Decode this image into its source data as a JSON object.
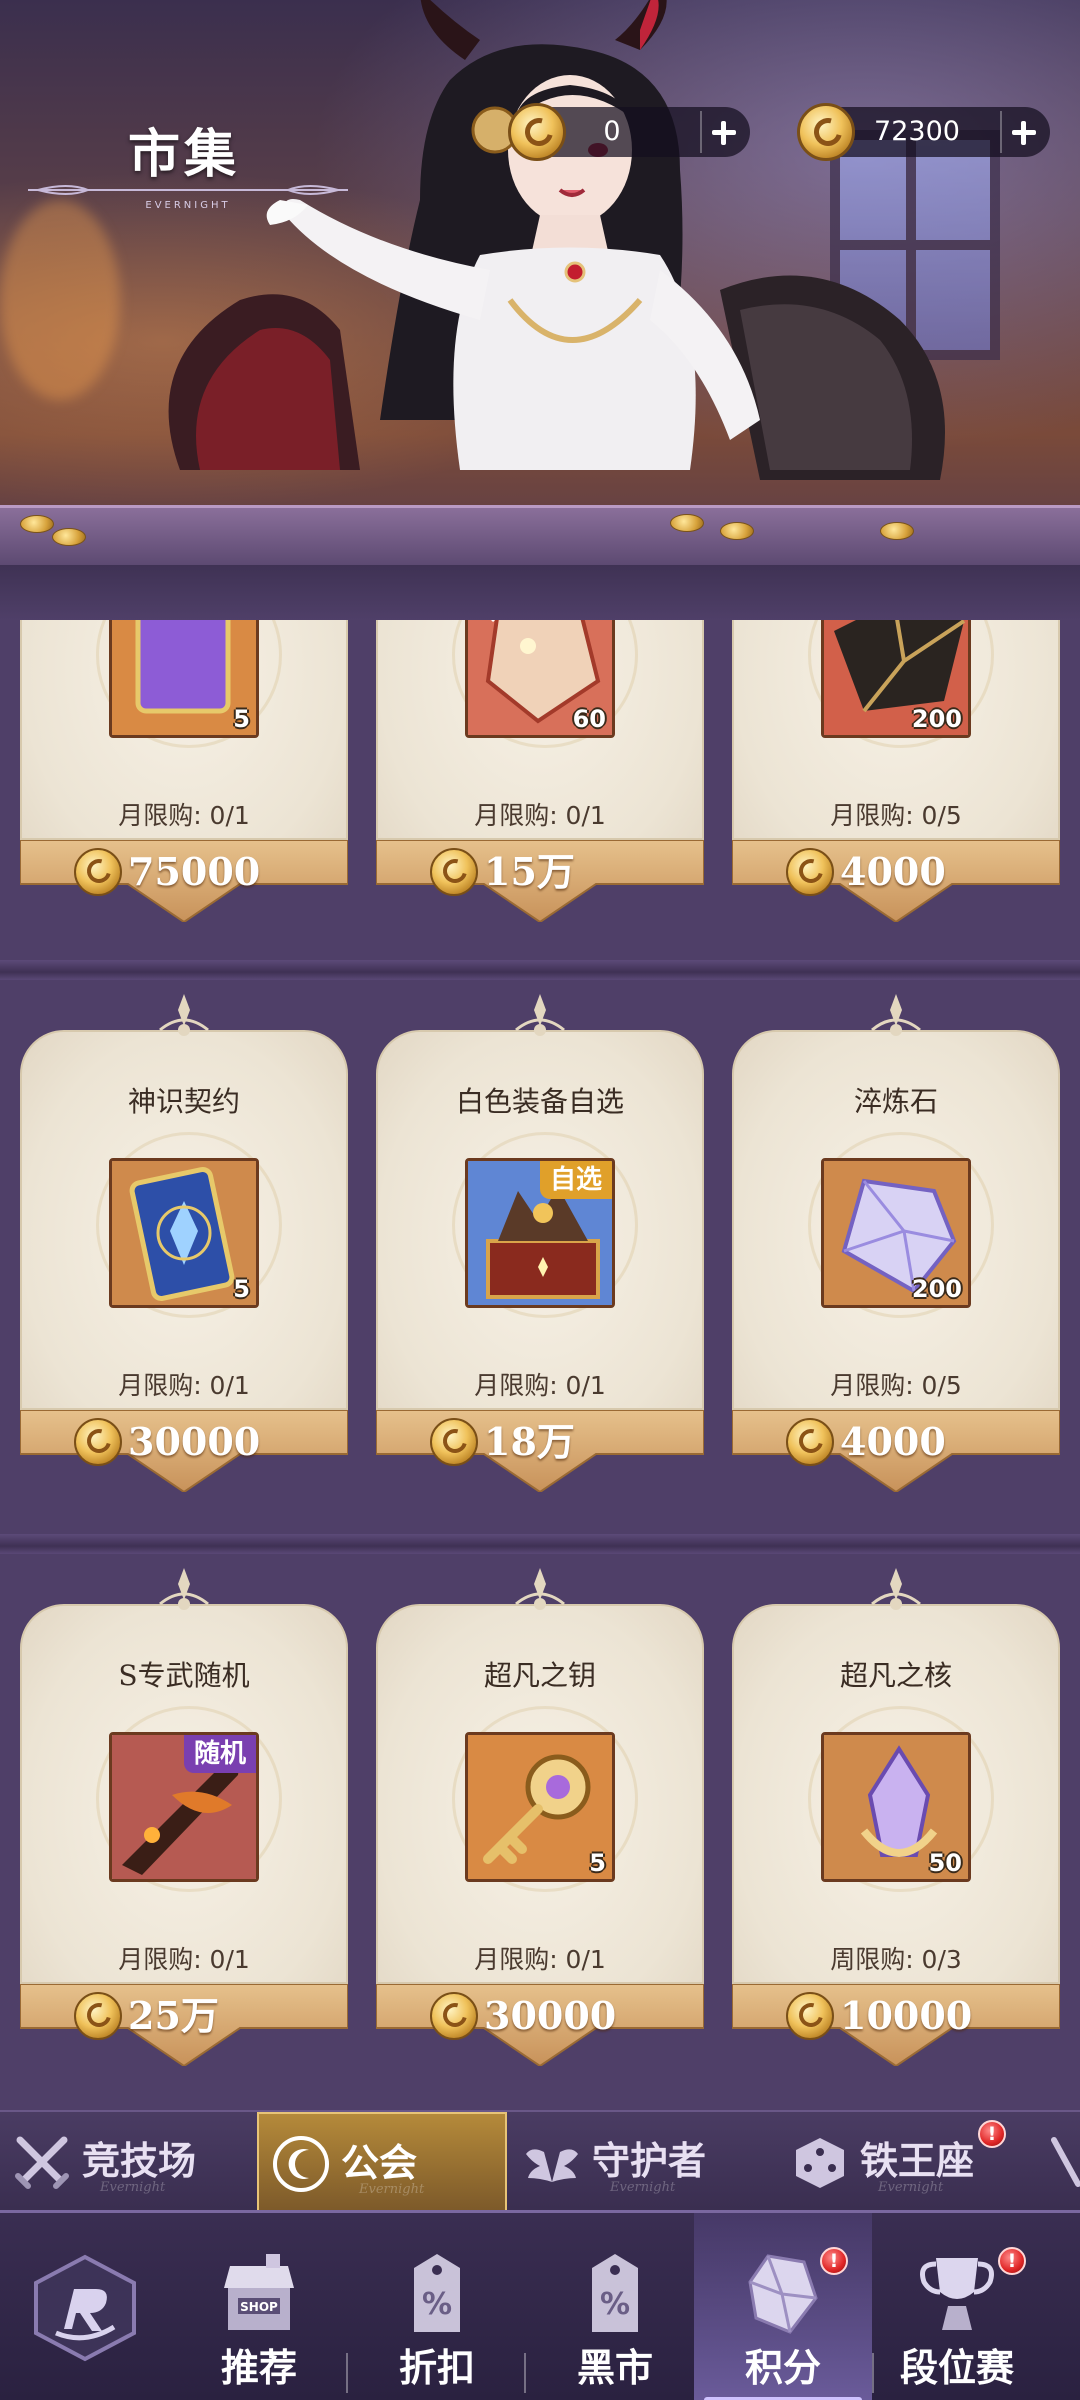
{
  "header": {
    "title": "市集",
    "title_sub": "EVERNIGHT",
    "currencies": [
      {
        "name": "gold-token",
        "value": "0"
      },
      {
        "name": "moon-coin",
        "value": "72300"
      }
    ]
  },
  "shop": {
    "rows": [
      [
        {
          "name": "",
          "qty": "5",
          "limit": "月限购: 0/1",
          "price": "75000",
          "art": "tarot-card"
        },
        {
          "name": "",
          "qty": "60",
          "limit": "月限购: 0/1",
          "price": "15万",
          "art": "red-crystal"
        },
        {
          "name": "",
          "qty": "200",
          "limit": "月限购: 0/5",
          "price": "4000",
          "art": "dark-stone"
        }
      ],
      [
        {
          "name": "神识契约",
          "qty": "5",
          "limit": "月限购: 0/1",
          "price": "30000",
          "art": "blue-card"
        },
        {
          "name": "白色装备自选",
          "tag": "自选",
          "qty": "",
          "limit": "月限购: 0/1",
          "price": "18万",
          "art": "equipment-chest"
        },
        {
          "name": "淬炼石",
          "qty": "200",
          "limit": "月限购: 0/5",
          "price": "4000",
          "art": "purple-crystal"
        }
      ],
      [
        {
          "name": "S专武随机",
          "tag": "随机",
          "qty": "",
          "limit": "月限购: 0/1",
          "price": "25万",
          "art": "weapon"
        },
        {
          "name": "超凡之钥",
          "qty": "5",
          "limit": "月限购: 0/1",
          "price": "30000",
          "art": "golden-key"
        },
        {
          "name": "超凡之核",
          "qty": "50",
          "limit": "周限购: 0/3",
          "price": "10000",
          "art": "violet-core"
        }
      ]
    ]
  },
  "tabs": {
    "sub_label": "Evernight",
    "items": [
      {
        "label": "竞技场",
        "icon": "crossed-swords-icon",
        "active": false
      },
      {
        "label": "公会",
        "icon": "moon-coin-icon",
        "active": true
      },
      {
        "label": "守护者",
        "icon": "wings-icon",
        "active": false
      },
      {
        "label": "铁王座",
        "icon": "dice-icon",
        "active": false,
        "alert": "!"
      }
    ]
  },
  "bottom_nav": {
    "items": [
      {
        "label": "推荐",
        "icon": "shop-icon"
      },
      {
        "label": "折扣",
        "icon": "discount-tag-icon"
      },
      {
        "label": "黑市",
        "icon": "discount-tag-icon"
      },
      {
        "label": "积分",
        "icon": "crystal-icon",
        "active": true,
        "alert": "!"
      },
      {
        "label": "段位赛",
        "icon": "trophy-icon",
        "alert": "!"
      }
    ]
  },
  "colors": {
    "background": "#4f3f68",
    "card": "#f3ede2",
    "price_banner": "#d9b07a",
    "accent_gold": "#e8c477",
    "alert": "#e02626"
  }
}
